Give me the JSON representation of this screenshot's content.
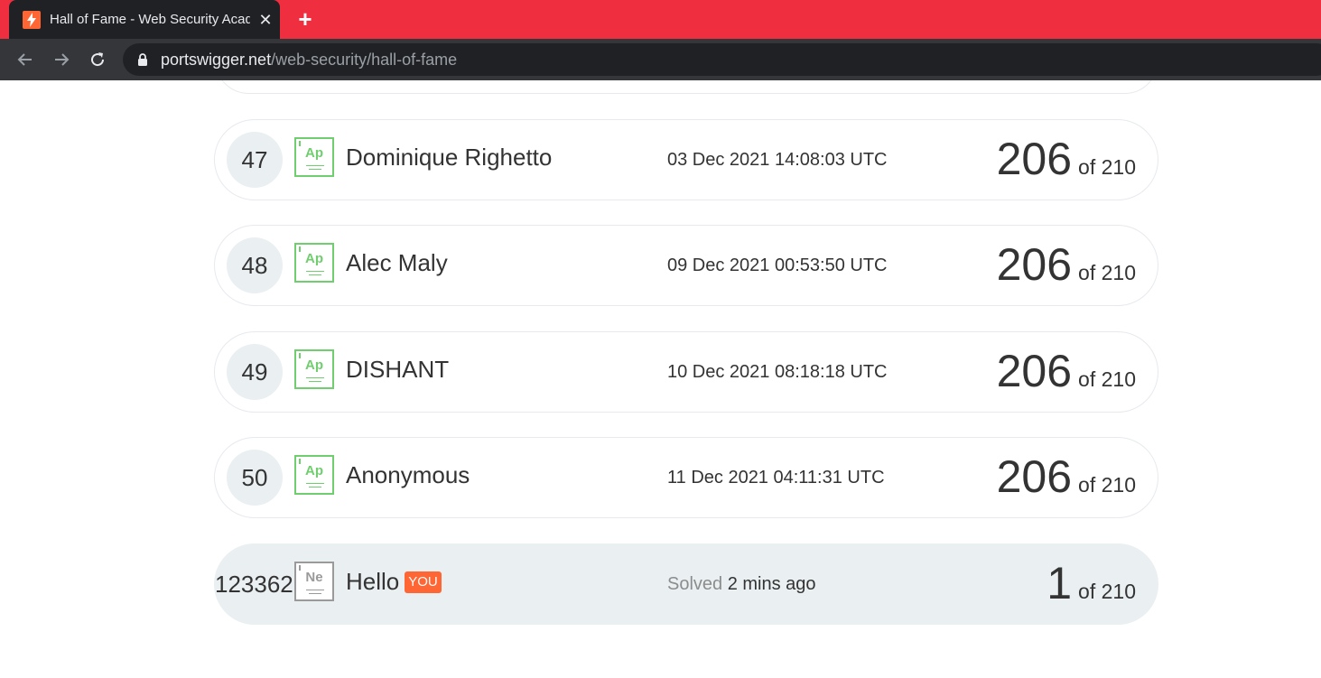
{
  "browser": {
    "tab_title": "Hall of Fame - Web Security Academy",
    "new_tab_label": "+",
    "close_label": "✕",
    "url_host": "portswigger.net",
    "url_path": "/web-security/hall-of-fame"
  },
  "leaderboard": {
    "rows": [
      {
        "rank": "47",
        "level": "Ap",
        "name": "Dominique Righetto",
        "time": "03 Dec 2021 14:08:03 UTC",
        "score": "206",
        "total": "of 210"
      },
      {
        "rank": "48",
        "level": "Ap",
        "name": "Alec Maly",
        "time": "09 Dec 2021 00:53:50 UTC",
        "score": "206",
        "total": "of 210"
      },
      {
        "rank": "49",
        "level": "Ap",
        "name": "DISHANT",
        "time": "10 Dec 2021 08:18:18 UTC",
        "score": "206",
        "total": "of 210"
      },
      {
        "rank": "50",
        "level": "Ap",
        "name": "Anonymous",
        "time": "11 Dec 2021 04:11:31 UTC",
        "score": "206",
        "total": "of 210"
      }
    ],
    "you_row": {
      "rank": "123362",
      "level": "Ne",
      "name": "Hello",
      "badge": "YOU",
      "solved_label": "Solved",
      "solved_time": "2 mins ago",
      "score": "1",
      "total": "of 210"
    }
  },
  "colors": {
    "tabbar": "#ef2e40",
    "accent": "#ff6633",
    "level_apprentice": "#70ce6f",
    "level_novice": "#9a9a9a"
  }
}
